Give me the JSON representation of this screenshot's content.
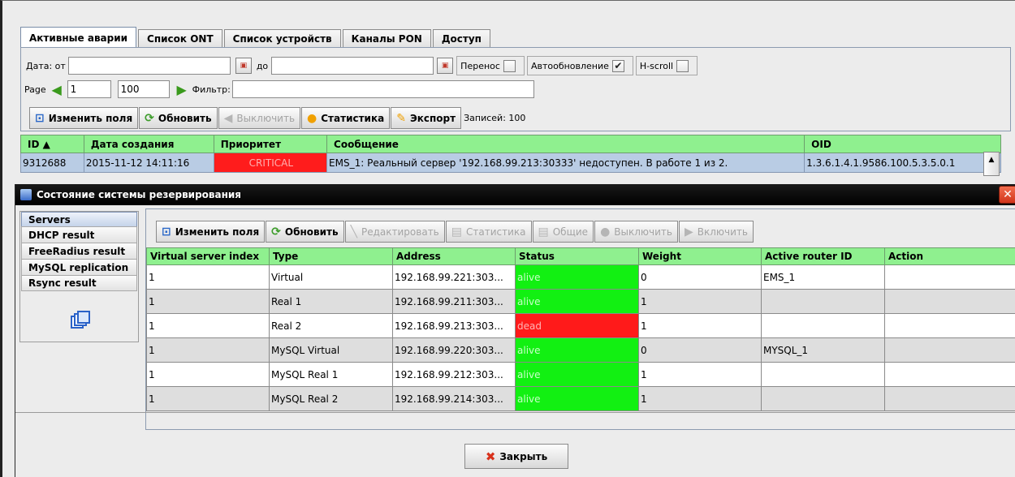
{
  "back": {
    "tabs": [
      "Активные аварии",
      "Список ONT",
      "Список устройств",
      "Каналы PON",
      "Доступ"
    ],
    "date_from_label": "Дата: от",
    "date_to_label": "до",
    "transfer_label": "Перенос",
    "autoupdate_label": "Автообновление",
    "hscroll_label": "H-scroll",
    "page_label": "Page",
    "page_value": "1",
    "page_size": "100",
    "filter_label": "Фильтр:",
    "toolbar": {
      "edit_fields": "Изменить поля",
      "refresh": "Обновить",
      "disable": "Выключить",
      "stats": "Статистика",
      "export": "Экспорт",
      "records": "Записей: 100"
    },
    "table": {
      "headers": [
        "ID ▲",
        "Дата создания",
        "Приоритет",
        "Сообщение",
        "OID"
      ],
      "row": [
        "9312688",
        "2015-11-12 14:11:16",
        "CRITICAL",
        "EMS_1: Реальный сервер '192.168.99.213:30333' недоступен. В работе 1 из 2.",
        "1.3.6.1.4.1.9586.100.5.3.5.0.1"
      ]
    }
  },
  "dialog": {
    "title": "Состояние системы резервирования",
    "side_items": [
      "Servers",
      "DHCP result",
      "FreeRadius result",
      "MySQL replication",
      "Rsync result"
    ],
    "toolbar": {
      "edit_fields": "Изменить поля",
      "refresh": "Обновить",
      "edit": "Редактировать",
      "stats": "Статистика",
      "general": "Общие",
      "disable": "Выключить",
      "enable": "Включить"
    },
    "table": {
      "headers": [
        "Virtual server index",
        "Type",
        "Address",
        "Status",
        "Weight",
        "Active router ID",
        "Action"
      ],
      "rows": [
        [
          "1",
          "Virtual",
          "192.168.99.221:303...",
          "alive",
          "0",
          "EMS_1",
          ""
        ],
        [
          "1",
          "Real 1",
          "192.168.99.211:303...",
          "alive",
          "1",
          "",
          ""
        ],
        [
          "1",
          "Real 2",
          "192.168.99.213:303...",
          "dead",
          "1",
          "",
          ""
        ],
        [
          "1",
          "MySQL Virtual",
          "192.168.99.220:303...",
          "alive",
          "0",
          "MYSQL_1",
          ""
        ],
        [
          "1",
          "MySQL Real 1",
          "192.168.99.212:303...",
          "alive",
          "1",
          "",
          ""
        ],
        [
          "1",
          "MySQL Real 2",
          "192.168.99.214:303...",
          "alive",
          "1",
          "",
          ""
        ]
      ]
    },
    "close_label": "Закрыть"
  },
  "colors": {
    "header_green": "#8ff08f",
    "alive": "#12f012",
    "dead": "#ff1a1a",
    "critical": "#ff1c1c",
    "selection": "#b9cce4"
  }
}
